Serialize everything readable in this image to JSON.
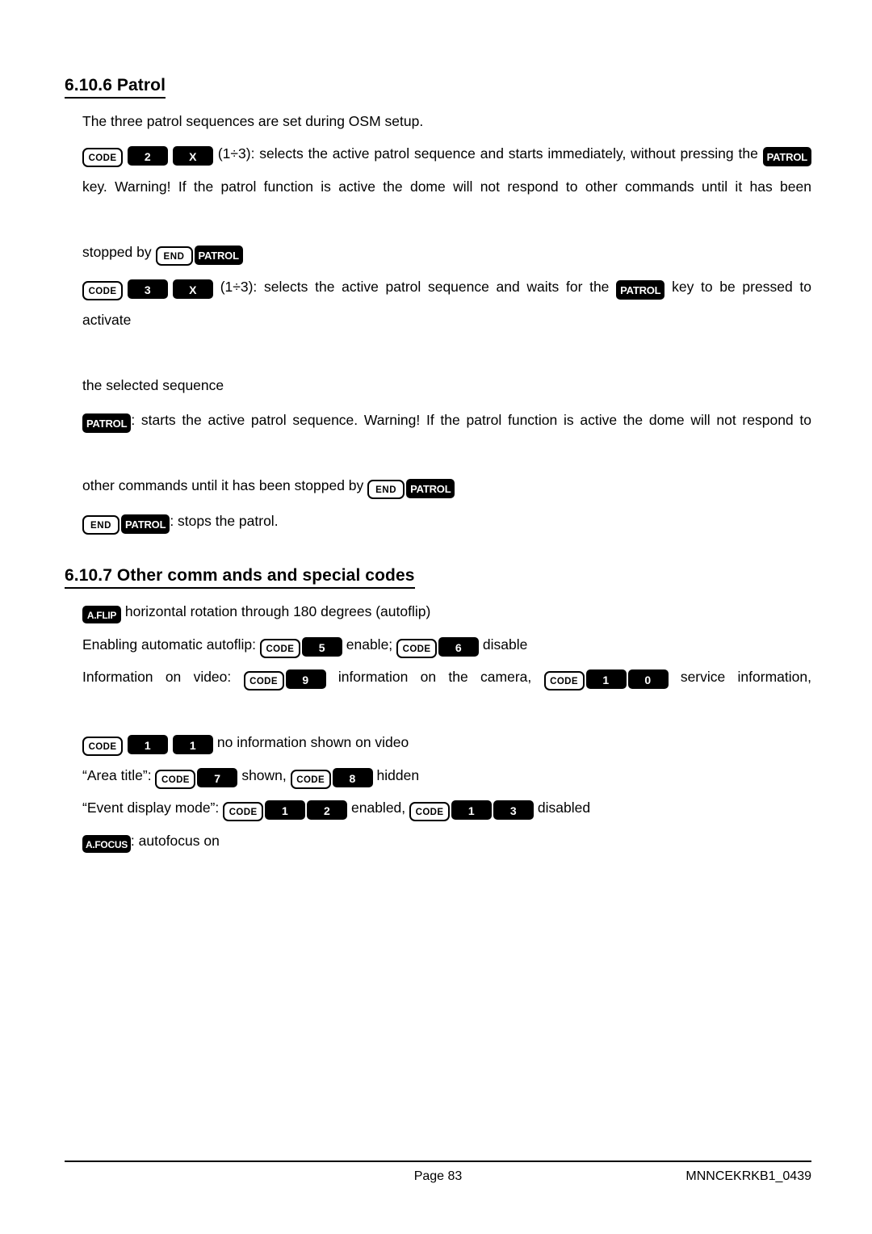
{
  "document": {
    "page_label": "Page 83",
    "doc_code": "MNNCEKRKB1_0439"
  },
  "sections": [
    {
      "number": "6.10.6",
      "title": "6.10.6 Patrol",
      "heading_text": "6.10.6 Patrol"
    },
    {
      "number": "6.10.7",
      "title": "6.10.7 Other comm ands and special codes",
      "heading_text": "6.10.7 Other comm ands and special codes"
    }
  ],
  "patrol": {
    "intro": "The three patrol sequences are set during OSM setup.",
    "cmd_code2_desc_a": "(1÷3): selects the active patrol sequence and starts immediately, without pressing the",
    "cmd_code2_desc_b": "key. Warning! If the patrol function is active the dome will not respond to other commands until it has been",
    "cmd_code2_desc_c": "stopped by",
    "cmd_code3_desc_a": "(1÷3): selects the active patrol sequence and waits for the",
    "cmd_code3_desc_b": "key to be pressed to activate",
    "cmd_code3_desc_c": "the selected sequence",
    "cmd_patrol_desc_a": ": starts the active patrol sequence. Warning! If the patrol function is active the dome will not respond to",
    "cmd_patrol_desc_b": "other commands until it has been stopped by",
    "cmd_stop_desc": ": stops the patrol."
  },
  "other_commands": {
    "autoflip_desc": "horizontal rotation through 180 degrees (autoflip)",
    "enabling_label": "Enabling automatic autoflip:",
    "enable_word": "enable;",
    "disable_word": "disable",
    "info_label": "Information on video:",
    "info_camera": "information on the camera,",
    "info_service": "service information,",
    "info_none": "no information shown on video",
    "area_title_label": "“Area title”:",
    "shown_word": "shown,",
    "hidden_word": "hidden",
    "event_mode_label": "“Event display mode”:",
    "enabled_word": "enabled,",
    "disabled_word": "disabled",
    "autofocus_desc": ": autofocus on"
  },
  "keys": {
    "code": "CODE",
    "end": "END",
    "patrol": "PATROL",
    "aflip": "A.FLIP",
    "afocus": "A.FOCUS",
    "x": "X",
    "n0": "0",
    "n1": "1",
    "n2": "2",
    "n3": "3",
    "n5": "5",
    "n6": "6",
    "n7": "7",
    "n8": "8",
    "n9": "9"
  },
  "colors": {
    "key_dark_bg": "#000000",
    "key_dark_fg": "#ffffff",
    "key_light_bg": "#ffffff",
    "key_light_fg": "#000000",
    "page_bg": "#ffffff",
    "text": "#000000"
  }
}
